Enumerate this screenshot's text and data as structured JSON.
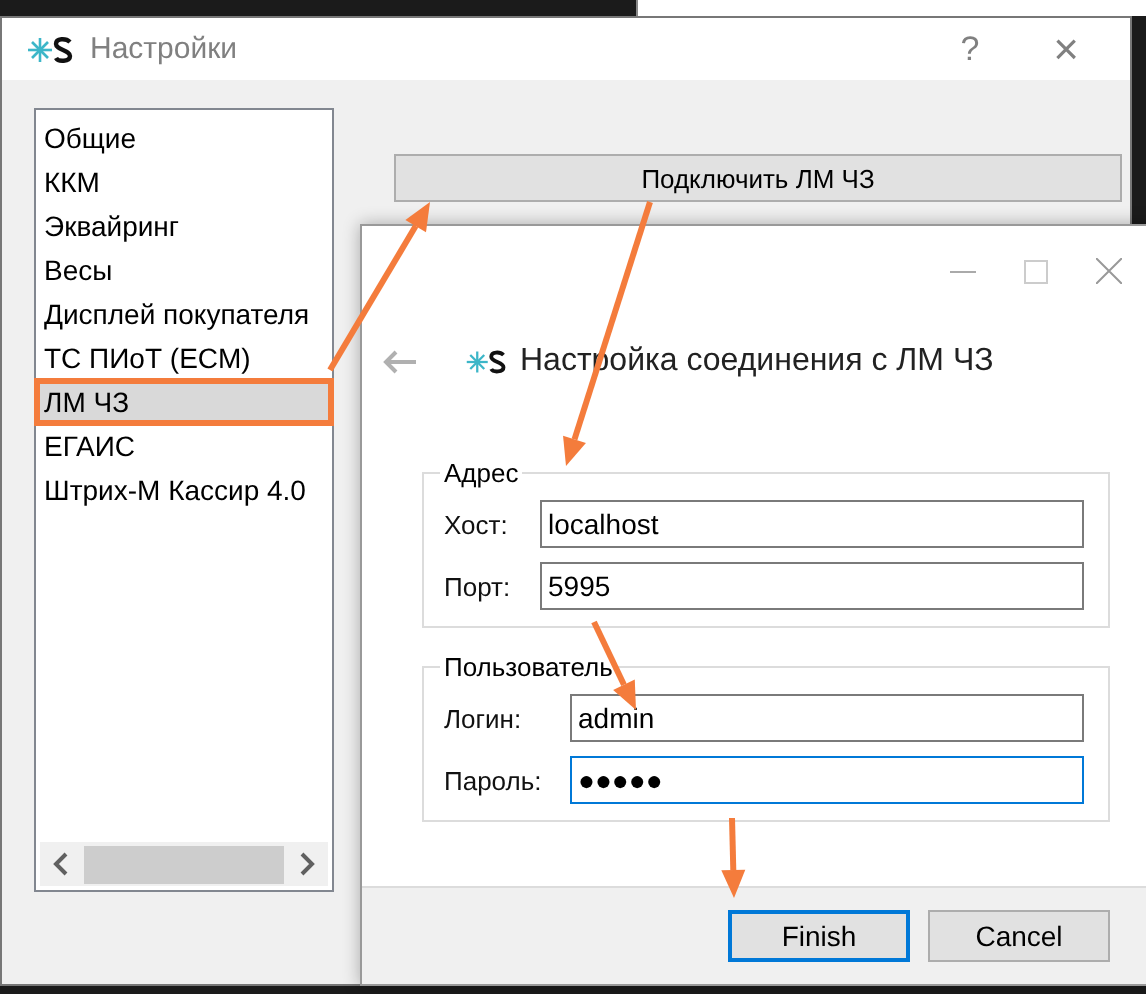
{
  "main_window": {
    "title": "Настройки",
    "help": "?",
    "close": "×"
  },
  "settings_list": [
    {
      "label": "Общие",
      "selected": false,
      "highlighted": false
    },
    {
      "label": "ККМ",
      "selected": false,
      "highlighted": false
    },
    {
      "label": "Эквайринг",
      "selected": false,
      "highlighted": false
    },
    {
      "label": "Весы",
      "selected": false,
      "highlighted": false
    },
    {
      "label": "Дисплей покупателя",
      "selected": false,
      "highlighted": false
    },
    {
      "label": "ТС ПИоТ (ECM)",
      "selected": false,
      "highlighted": false
    },
    {
      "label": "ЛМ ЧЗ",
      "selected": true,
      "highlighted": true
    },
    {
      "label": "ЕГАИС",
      "selected": false,
      "highlighted": false
    },
    {
      "label": "Штрих-М Кассир 4.0",
      "selected": false,
      "highlighted": false
    }
  ],
  "connect_button": "Подключить ЛМ ЧЗ",
  "dialog": {
    "header": "Настройка соединения с ЛМ ЧЗ",
    "groups": [
      {
        "title": "Адрес",
        "fields": [
          {
            "label": "Хост:",
            "value": "localhost",
            "focused": false
          },
          {
            "label": "Порт:",
            "value": "5995",
            "focused": false
          }
        ]
      },
      {
        "title": "Пользователь",
        "fields": [
          {
            "label": "Логин:",
            "value": "admin",
            "focused": false
          },
          {
            "label": "Пароль:",
            "value": "●●●●●",
            "focused": true
          }
        ]
      }
    ],
    "buttons": [
      {
        "label": "Finish",
        "default": true
      },
      {
        "label": "Cancel",
        "default": false
      }
    ]
  }
}
